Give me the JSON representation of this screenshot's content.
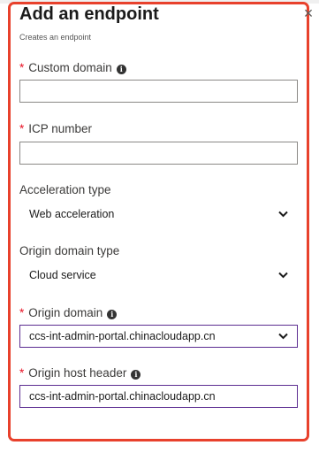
{
  "panel": {
    "title": "Add an endpoint",
    "subtitle": "Creates an endpoint",
    "close_glyph": "×",
    "required_marker": "*",
    "info_glyph": "i"
  },
  "fields": {
    "custom_domain": {
      "label": "Custom domain",
      "value": "",
      "required": true
    },
    "icp_number": {
      "label": "ICP number",
      "value": "",
      "required": true
    },
    "acceleration_type": {
      "label": "Acceleration type",
      "selected": "Web acceleration"
    },
    "origin_domain_type": {
      "label": "Origin domain type",
      "selected": "Cloud service"
    },
    "origin_domain": {
      "label": "Origin domain",
      "selected": "ccs-int-admin-portal.chinacloudapp.cn",
      "required": true
    },
    "origin_host_header": {
      "label": "Origin host header",
      "value": "ccs-int-admin-portal.chinacloudapp.cn",
      "required": true
    }
  },
  "colors": {
    "highlight_border": "#e8412c",
    "required_asterisk": "#e81123",
    "focus_border": "#5c2d91"
  },
  "icons": {
    "close": "close-icon",
    "info": "info-icon",
    "dropdown": "chevron-down-icon"
  }
}
